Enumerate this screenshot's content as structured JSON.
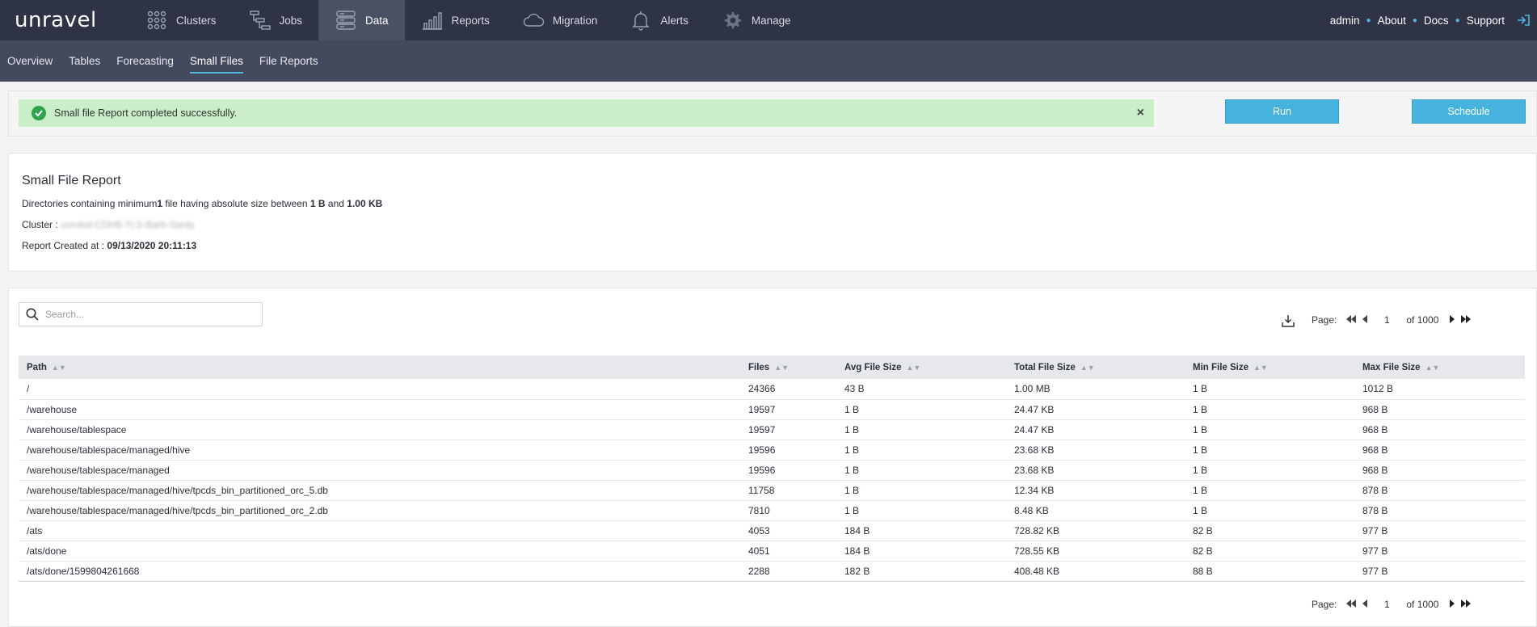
{
  "app": {
    "logo": "unravel"
  },
  "nav": {
    "items": [
      {
        "label": "Clusters",
        "icon": "clusters-icon"
      },
      {
        "label": "Jobs",
        "icon": "jobs-icon"
      },
      {
        "label": "Data",
        "icon": "data-icon",
        "active": true
      },
      {
        "label": "Reports",
        "icon": "reports-icon"
      },
      {
        "label": "Migration",
        "icon": "cloud-icon"
      },
      {
        "label": "Alerts",
        "icon": "bell-icon"
      },
      {
        "label": "Manage",
        "icon": "gear-icon"
      }
    ],
    "right": {
      "user": "admin",
      "about": "About",
      "docs": "Docs",
      "support": "Support"
    }
  },
  "subnav": {
    "tabs": [
      {
        "label": "Overview"
      },
      {
        "label": "Tables"
      },
      {
        "label": "Forecasting"
      },
      {
        "label": "Small Files",
        "active": true
      },
      {
        "label": "File Reports"
      }
    ]
  },
  "alert": {
    "message": "Small file Report completed successfully.",
    "close": "×"
  },
  "actions": {
    "run": "Run",
    "schedule": "Schedule"
  },
  "report": {
    "title": "Small File Report",
    "desc_prefix": "Directories containing minimum",
    "min_files": "1",
    "desc_mid": " file having absolute size between ",
    "min_size": "1 B",
    "and": " and ",
    "max_size": "1.00 KB",
    "cluster_label": "Cluster : ",
    "cluster_value": "unrvlsd-CDH6-TLS-Barb-Santy",
    "created_label": "Report Created at : ",
    "created_value": "09/13/2020 20:11:13"
  },
  "search": {
    "placeholder": "Search..."
  },
  "pager": {
    "label": "Page:",
    "page": "1",
    "of": "of 1000"
  },
  "table": {
    "columns": [
      "Path",
      "Files",
      "Avg File Size",
      "Total File Size",
      "Min File Size",
      "Max File Size"
    ],
    "rows": [
      [
        "/",
        "24366",
        "43 B",
        "1.00 MB",
        "1 B",
        "1012 B"
      ],
      [
        "/warehouse",
        "19597",
        "1 B",
        "24.47 KB",
        "1 B",
        "968 B"
      ],
      [
        "/warehouse/tablespace",
        "19597",
        "1 B",
        "24.47 KB",
        "1 B",
        "968 B"
      ],
      [
        "/warehouse/tablespace/managed/hive",
        "19596",
        "1 B",
        "23.68 KB",
        "1 B",
        "968 B"
      ],
      [
        "/warehouse/tablespace/managed",
        "19596",
        "1 B",
        "23.68 KB",
        "1 B",
        "968 B"
      ],
      [
        "/warehouse/tablespace/managed/hive/tpcds_bin_partitioned_orc_5.db",
        "11758",
        "1 B",
        "12.34 KB",
        "1 B",
        "878 B"
      ],
      [
        "/warehouse/tablespace/managed/hive/tpcds_bin_partitioned_orc_2.db",
        "7810",
        "1 B",
        "8.48 KB",
        "1 B",
        "878 B"
      ],
      [
        "/ats",
        "4053",
        "184 B",
        "728.82 KB",
        "82 B",
        "977 B"
      ],
      [
        "/ats/done",
        "4051",
        "184 B",
        "728.55 KB",
        "82 B",
        "977 B"
      ],
      [
        "/ats/done/1599804261668",
        "2288",
        "182 B",
        "408.48 KB",
        "88 B",
        "977 B"
      ]
    ]
  },
  "colors": {
    "nav_bg": "#2e3445",
    "subnav_bg": "#434a5e",
    "accent": "#45b3de",
    "success_bg": "#c9eec8"
  }
}
